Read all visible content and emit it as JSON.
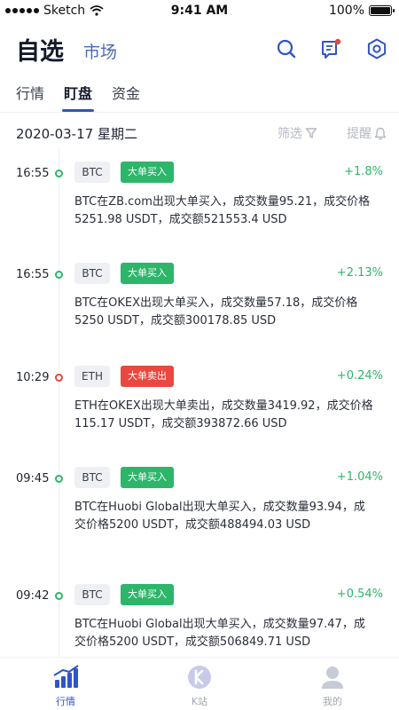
{
  "status_bar": {
    "carrier": "Sketch",
    "time": "9:41 AM",
    "battery": "100%"
  },
  "header": {
    "title": "自选",
    "subtitle": "市场"
  },
  "tabs": [
    {
      "label": "行情",
      "active": false
    },
    {
      "label": "盯盘",
      "active": true
    },
    {
      "label": "资金",
      "active": false
    }
  ],
  "date_bar": {
    "date": "2020-03-17 星期二",
    "filter_label": "筛选",
    "remind_label": "提醒"
  },
  "entries": [
    {
      "time": "16:55",
      "coin": "BTC",
      "tag": "大单买入",
      "change": "+1.8%",
      "side": "buy",
      "text": "BTC在ZB.com出现大单买入，成交数量95.21，成交价格5251.98 USDT，成交额521553.4 USD"
    },
    {
      "time": "16:55",
      "coin": "BTC",
      "tag": "大单买入",
      "change": "+2.13%",
      "side": "buy",
      "text": "BTC在OKEX出现大单买入，成交数量57.18，成交价格5250 USDT，成交额300178.85 USD"
    },
    {
      "time": "10:29",
      "coin": "ETH",
      "tag": "大单卖出",
      "change": "+0.24%",
      "side": "sell",
      "text": "ETH在OKEX出现大单卖出，成交数量3419.92，成交价格115.17 USDT，成交额393872.66 USD"
    },
    {
      "time": "09:45",
      "coin": "BTC",
      "tag": "大单买入",
      "change": "+1.04%",
      "side": "buy",
      "text": "BTC在Huobi Global出现大单买入，成交数量93.94，成交价格5200 USDT，成交额488494.03 USD"
    },
    {
      "time": "09:42",
      "coin": "BTC",
      "tag": "大单买入",
      "change": "+0.54%",
      "side": "buy",
      "text": "BTC在Huobi Global出现大单买入，成交数量97.47，成交价格5200 USDT，成交额506849.71 USD"
    }
  ],
  "bottom_nav": [
    {
      "label": "行情",
      "icon": "chart-bars-icon",
      "active": true
    },
    {
      "label": "K站",
      "icon": "k-circle-icon",
      "active": false
    },
    {
      "label": "我的",
      "icon": "user-icon",
      "active": false
    }
  ],
  "colors": {
    "accent": "#2f55c6",
    "buy": "#2db66a",
    "sell": "#e8483f",
    "muted": "#b5b8c1"
  }
}
